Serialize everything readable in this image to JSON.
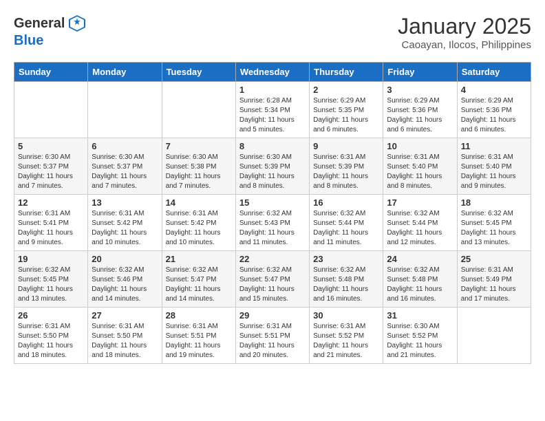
{
  "header": {
    "logo_general": "General",
    "logo_blue": "Blue",
    "month_year": "January 2025",
    "location": "Caoayan, Ilocos, Philippines"
  },
  "weekdays": [
    "Sunday",
    "Monday",
    "Tuesday",
    "Wednesday",
    "Thursday",
    "Friday",
    "Saturday"
  ],
  "weeks": [
    [
      {
        "day": "",
        "info": ""
      },
      {
        "day": "",
        "info": ""
      },
      {
        "day": "",
        "info": ""
      },
      {
        "day": "1",
        "info": "Sunrise: 6:28 AM\nSunset: 5:34 PM\nDaylight: 11 hours and 5 minutes."
      },
      {
        "day": "2",
        "info": "Sunrise: 6:29 AM\nSunset: 5:35 PM\nDaylight: 11 hours and 6 minutes."
      },
      {
        "day": "3",
        "info": "Sunrise: 6:29 AM\nSunset: 5:36 PM\nDaylight: 11 hours and 6 minutes."
      },
      {
        "day": "4",
        "info": "Sunrise: 6:29 AM\nSunset: 5:36 PM\nDaylight: 11 hours and 6 minutes."
      }
    ],
    [
      {
        "day": "5",
        "info": "Sunrise: 6:30 AM\nSunset: 5:37 PM\nDaylight: 11 hours and 7 minutes."
      },
      {
        "day": "6",
        "info": "Sunrise: 6:30 AM\nSunset: 5:37 PM\nDaylight: 11 hours and 7 minutes."
      },
      {
        "day": "7",
        "info": "Sunrise: 6:30 AM\nSunset: 5:38 PM\nDaylight: 11 hours and 7 minutes."
      },
      {
        "day": "8",
        "info": "Sunrise: 6:30 AM\nSunset: 5:39 PM\nDaylight: 11 hours and 8 minutes."
      },
      {
        "day": "9",
        "info": "Sunrise: 6:31 AM\nSunset: 5:39 PM\nDaylight: 11 hours and 8 minutes."
      },
      {
        "day": "10",
        "info": "Sunrise: 6:31 AM\nSunset: 5:40 PM\nDaylight: 11 hours and 8 minutes."
      },
      {
        "day": "11",
        "info": "Sunrise: 6:31 AM\nSunset: 5:40 PM\nDaylight: 11 hours and 9 minutes."
      }
    ],
    [
      {
        "day": "12",
        "info": "Sunrise: 6:31 AM\nSunset: 5:41 PM\nDaylight: 11 hours and 9 minutes."
      },
      {
        "day": "13",
        "info": "Sunrise: 6:31 AM\nSunset: 5:42 PM\nDaylight: 11 hours and 10 minutes."
      },
      {
        "day": "14",
        "info": "Sunrise: 6:31 AM\nSunset: 5:42 PM\nDaylight: 11 hours and 10 minutes."
      },
      {
        "day": "15",
        "info": "Sunrise: 6:32 AM\nSunset: 5:43 PM\nDaylight: 11 hours and 11 minutes."
      },
      {
        "day": "16",
        "info": "Sunrise: 6:32 AM\nSunset: 5:44 PM\nDaylight: 11 hours and 11 minutes."
      },
      {
        "day": "17",
        "info": "Sunrise: 6:32 AM\nSunset: 5:44 PM\nDaylight: 11 hours and 12 minutes."
      },
      {
        "day": "18",
        "info": "Sunrise: 6:32 AM\nSunset: 5:45 PM\nDaylight: 11 hours and 13 minutes."
      }
    ],
    [
      {
        "day": "19",
        "info": "Sunrise: 6:32 AM\nSunset: 5:45 PM\nDaylight: 11 hours and 13 minutes."
      },
      {
        "day": "20",
        "info": "Sunrise: 6:32 AM\nSunset: 5:46 PM\nDaylight: 11 hours and 14 minutes."
      },
      {
        "day": "21",
        "info": "Sunrise: 6:32 AM\nSunset: 5:47 PM\nDaylight: 11 hours and 14 minutes."
      },
      {
        "day": "22",
        "info": "Sunrise: 6:32 AM\nSunset: 5:47 PM\nDaylight: 11 hours and 15 minutes."
      },
      {
        "day": "23",
        "info": "Sunrise: 6:32 AM\nSunset: 5:48 PM\nDaylight: 11 hours and 16 minutes."
      },
      {
        "day": "24",
        "info": "Sunrise: 6:32 AM\nSunset: 5:48 PM\nDaylight: 11 hours and 16 minutes."
      },
      {
        "day": "25",
        "info": "Sunrise: 6:31 AM\nSunset: 5:49 PM\nDaylight: 11 hours and 17 minutes."
      }
    ],
    [
      {
        "day": "26",
        "info": "Sunrise: 6:31 AM\nSunset: 5:50 PM\nDaylight: 11 hours and 18 minutes."
      },
      {
        "day": "27",
        "info": "Sunrise: 6:31 AM\nSunset: 5:50 PM\nDaylight: 11 hours and 18 minutes."
      },
      {
        "day": "28",
        "info": "Sunrise: 6:31 AM\nSunset: 5:51 PM\nDaylight: 11 hours and 19 minutes."
      },
      {
        "day": "29",
        "info": "Sunrise: 6:31 AM\nSunset: 5:51 PM\nDaylight: 11 hours and 20 minutes."
      },
      {
        "day": "30",
        "info": "Sunrise: 6:31 AM\nSunset: 5:52 PM\nDaylight: 11 hours and 21 minutes."
      },
      {
        "day": "31",
        "info": "Sunrise: 6:30 AM\nSunset: 5:52 PM\nDaylight: 11 hours and 21 minutes."
      },
      {
        "day": "",
        "info": ""
      }
    ]
  ]
}
